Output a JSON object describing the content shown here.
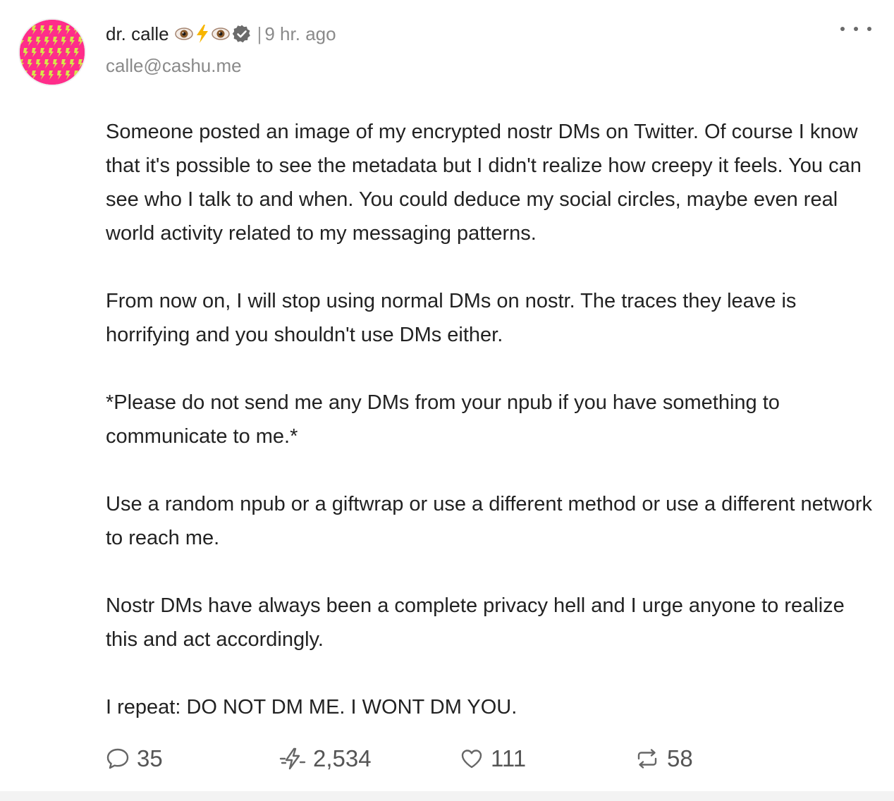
{
  "post": {
    "author_name": "dr. calle",
    "name_emojis": [
      "eye-icon",
      "lightning-icon",
      "eye-icon"
    ],
    "verified_icon": "verified-badge-icon",
    "separator": "|",
    "timestamp": "9 hr. ago",
    "handle": "calle@cashu.me",
    "more_icon": "more-options-icon",
    "paragraphs": [
      "Someone posted an image of my encrypted nostr DMs on Twitter. Of course I know that it's possible to see the metadata but I didn't realize how creepy it feels. You can see who I talk to and when. You could deduce my social circles, maybe even real world activity related to my messaging patterns.",
      "From now on, I will stop using normal DMs on nostr. The traces they leave is horrifying and you shouldn't use DMs either.",
      "*Please do not send me any DMs from your npub if you have something to communicate to me.*",
      "Use a random npub or a giftwrap or use a different method or use a different network to reach me.",
      "Nostr DMs have always been a complete privacy hell and I urge anyone to realize this and act accordingly.",
      "I repeat: DO NOT DM ME. I WONT DM YOU."
    ]
  },
  "actions": {
    "reply": {
      "icon": "comment-icon",
      "count": "35"
    },
    "zap": {
      "icon": "zap-icon",
      "count": "2,534"
    },
    "like": {
      "icon": "heart-icon",
      "count": "111"
    },
    "repost": {
      "icon": "repost-icon",
      "count": "58"
    }
  },
  "colors": {
    "avatar_background": "#ff2d8a",
    "avatar_pattern": "#c8e04a",
    "text": "#222222",
    "muted": "#8a8a8a"
  }
}
